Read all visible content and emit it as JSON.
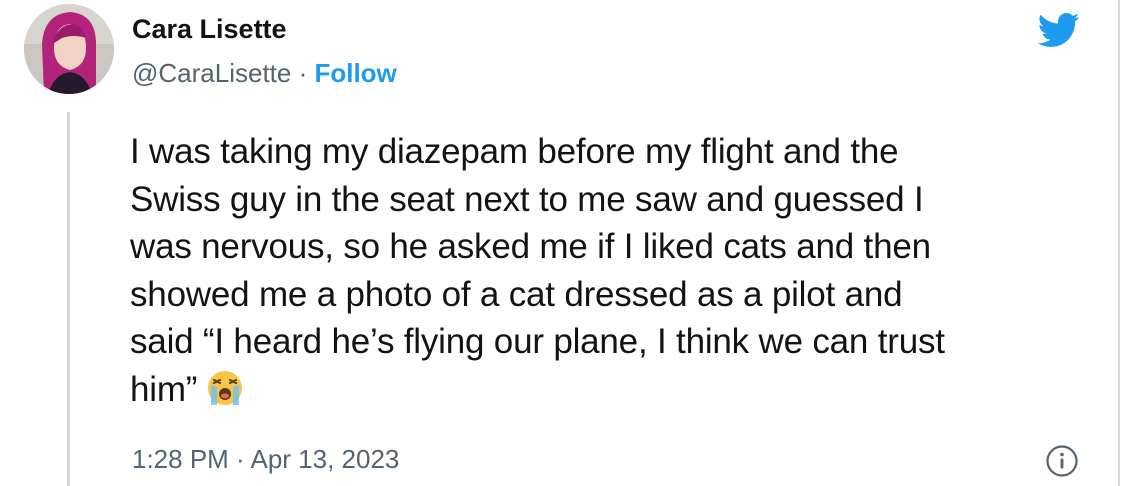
{
  "author": {
    "display_name": "Cara Lisette",
    "handle": "@CaraLisette",
    "separator": " · ",
    "follow_label": "Follow"
  },
  "tweet": {
    "lines": [
      "I was taking my diazepam before my flight and the",
      "Swiss guy in the seat next to me saw and guessed I",
      "was nervous, so he asked me if I liked cats and then",
      "showed me a photo of a cat dressed as a pilot and",
      "said “I heard he’s flying our plane, I think we can trust",
      "him”"
    ],
    "emoji": "loudly-crying-face"
  },
  "meta": {
    "timestamp": "1:28 PM · Apr 13, 2023"
  },
  "icons": {
    "brand": "twitter-bird-icon",
    "info": "info-icon"
  },
  "colors": {
    "accent": "#1d9bf0",
    "text": "#0f1419",
    "muted": "#536471",
    "avatar_hair": "#b5257e"
  }
}
